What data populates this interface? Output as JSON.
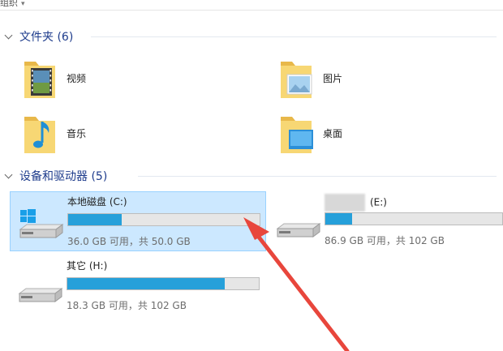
{
  "toolbar": {
    "crumb": "组织",
    "crumb_arrow": "▾"
  },
  "folders_group": {
    "label": "文件夹 (6)",
    "items": [
      {
        "label": "视频",
        "icon": "video-folder-icon"
      },
      {
        "label": "图片",
        "icon": "pictures-folder-icon"
      },
      {
        "label": "音乐",
        "icon": "music-folder-icon"
      },
      {
        "label": "桌面",
        "icon": "desktop-folder-icon"
      }
    ]
  },
  "devices_group": {
    "label": "设备和驱动器 (5)",
    "drives": [
      {
        "name": "本地磁盘 (C:)",
        "size_text": "36.0 GB 可用，共 50.0 GB",
        "used_fraction": 0.28,
        "selected": true,
        "icon": "windows-drive-icon"
      },
      {
        "name": "(E:)",
        "size_text": "86.9 GB 可用，共 102 GB",
        "used_fraction": 0.15,
        "selected": false,
        "icon": "hard-drive-icon"
      },
      {
        "name": "其它 (H:)",
        "size_text": "18.3 GB 可用，共 102 GB",
        "used_fraction": 0.82,
        "selected": false,
        "icon": "hard-drive-icon"
      }
    ]
  },
  "colors": {
    "accent": "#26a0da",
    "selected_bg": "#cce8ff",
    "header": "#1e3c8c",
    "annotation_arrow": "#e8463c"
  }
}
